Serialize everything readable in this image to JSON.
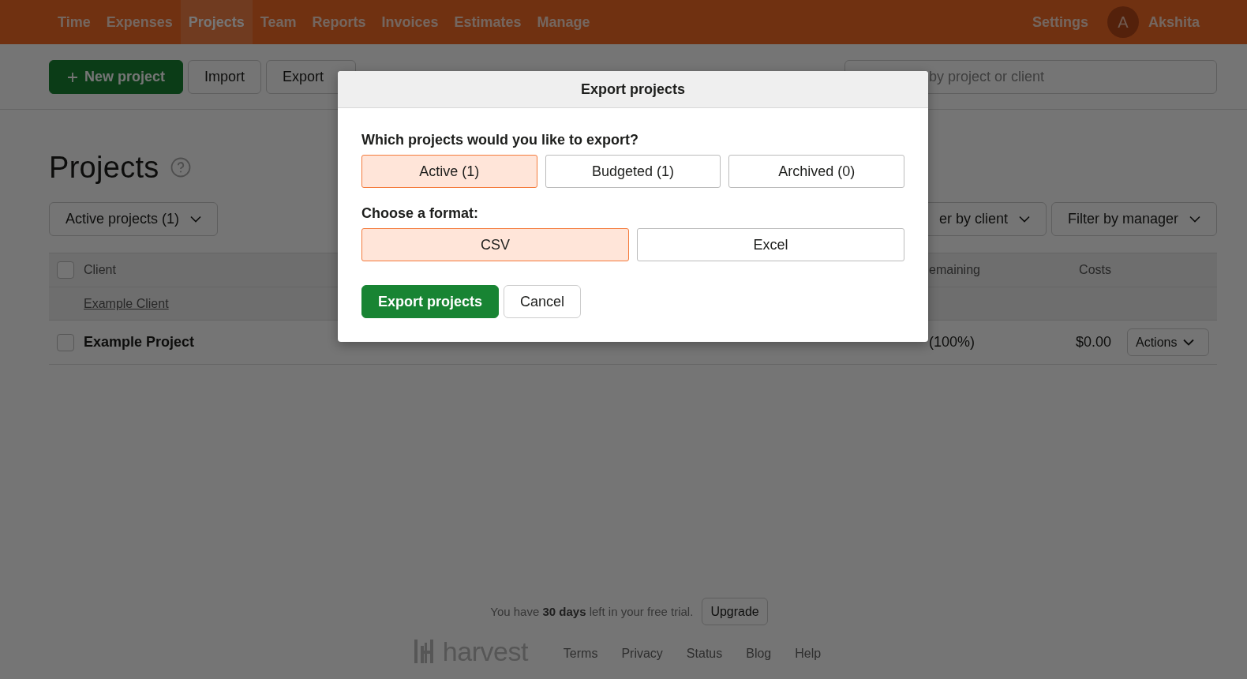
{
  "nav": {
    "items": [
      {
        "label": "Time",
        "selected": false
      },
      {
        "label": "Expenses",
        "selected": false
      },
      {
        "label": "Projects",
        "selected": true
      },
      {
        "label": "Team",
        "selected": false
      },
      {
        "label": "Reports",
        "selected": false
      },
      {
        "label": "Invoices",
        "selected": false
      },
      {
        "label": "Estimates",
        "selected": false
      },
      {
        "label": "Manage",
        "selected": false
      }
    ],
    "settings": "Settings",
    "user": {
      "initial": "A",
      "name": "Akshita"
    }
  },
  "toolbar": {
    "new_project": "New project",
    "import": "Import",
    "export": "Export",
    "search": {
      "placeholder": "by project or client"
    }
  },
  "title": "Projects",
  "filters": {
    "status": "Active projects (1)",
    "client": "er by client",
    "manager": "Filter by manager"
  },
  "table": {
    "select_all_checked": false,
    "columns": {
      "client": "Client",
      "remaining": "emaining",
      "costs": "Costs"
    },
    "groups": [
      {
        "client": "Example Client",
        "rows": [
          {
            "name": "Example Project",
            "checked": false,
            "remaining": "(100%)",
            "costs": "$0.00",
            "actions": "Actions"
          }
        ]
      }
    ]
  },
  "modal": {
    "title": "Export projects",
    "question": "Which projects would you like to export?",
    "scopes": [
      {
        "label": "Active (1)",
        "selected": true
      },
      {
        "label": "Budgeted (1)",
        "selected": false
      },
      {
        "label": "Archived (0)",
        "selected": false
      }
    ],
    "format_label": "Choose a format:",
    "formats": [
      {
        "label": "CSV",
        "selected": true
      },
      {
        "label": "Excel",
        "selected": false
      }
    ],
    "submit": "Export projects",
    "cancel": "Cancel"
  },
  "footer": {
    "trial": "You have **30 days** left in your free trial.",
    "upgrade": "Upgrade",
    "logo": "harvest",
    "links": [
      "Terms",
      "Privacy",
      "Status",
      "Blog",
      "Help"
    ]
  }
}
